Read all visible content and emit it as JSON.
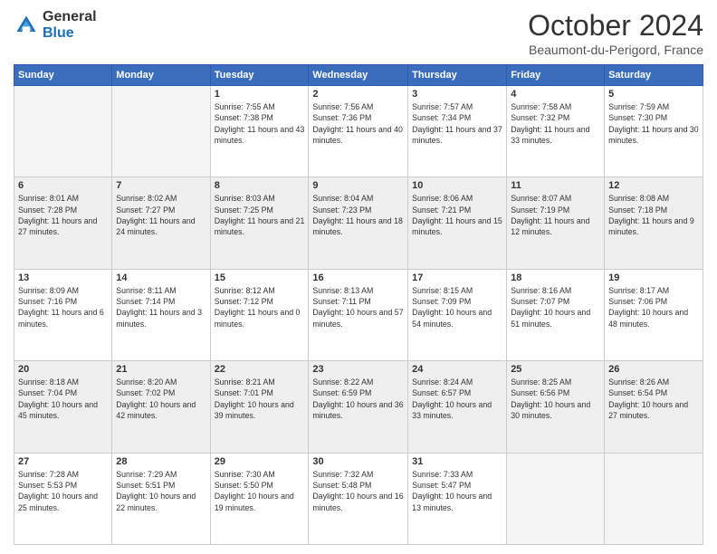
{
  "header": {
    "logo_general": "General",
    "logo_blue": "Blue",
    "month": "October 2024",
    "location": "Beaumont-du-Perigord, France"
  },
  "weekdays": [
    "Sunday",
    "Monday",
    "Tuesday",
    "Wednesday",
    "Thursday",
    "Friday",
    "Saturday"
  ],
  "weeks": [
    [
      {
        "day": "",
        "sunrise": "",
        "sunset": "",
        "daylight": ""
      },
      {
        "day": "",
        "sunrise": "",
        "sunset": "",
        "daylight": ""
      },
      {
        "day": "1",
        "sunrise": "Sunrise: 7:55 AM",
        "sunset": "Sunset: 7:38 PM",
        "daylight": "Daylight: 11 hours and 43 minutes."
      },
      {
        "day": "2",
        "sunrise": "Sunrise: 7:56 AM",
        "sunset": "Sunset: 7:36 PM",
        "daylight": "Daylight: 11 hours and 40 minutes."
      },
      {
        "day": "3",
        "sunrise": "Sunrise: 7:57 AM",
        "sunset": "Sunset: 7:34 PM",
        "daylight": "Daylight: 11 hours and 37 minutes."
      },
      {
        "day": "4",
        "sunrise": "Sunrise: 7:58 AM",
        "sunset": "Sunset: 7:32 PM",
        "daylight": "Daylight: 11 hours and 33 minutes."
      },
      {
        "day": "5",
        "sunrise": "Sunrise: 7:59 AM",
        "sunset": "Sunset: 7:30 PM",
        "daylight": "Daylight: 11 hours and 30 minutes."
      }
    ],
    [
      {
        "day": "6",
        "sunrise": "Sunrise: 8:01 AM",
        "sunset": "Sunset: 7:28 PM",
        "daylight": "Daylight: 11 hours and 27 minutes."
      },
      {
        "day": "7",
        "sunrise": "Sunrise: 8:02 AM",
        "sunset": "Sunset: 7:27 PM",
        "daylight": "Daylight: 11 hours and 24 minutes."
      },
      {
        "day": "8",
        "sunrise": "Sunrise: 8:03 AM",
        "sunset": "Sunset: 7:25 PM",
        "daylight": "Daylight: 11 hours and 21 minutes."
      },
      {
        "day": "9",
        "sunrise": "Sunrise: 8:04 AM",
        "sunset": "Sunset: 7:23 PM",
        "daylight": "Daylight: 11 hours and 18 minutes."
      },
      {
        "day": "10",
        "sunrise": "Sunrise: 8:06 AM",
        "sunset": "Sunset: 7:21 PM",
        "daylight": "Daylight: 11 hours and 15 minutes."
      },
      {
        "day": "11",
        "sunrise": "Sunrise: 8:07 AM",
        "sunset": "Sunset: 7:19 PM",
        "daylight": "Daylight: 11 hours and 12 minutes."
      },
      {
        "day": "12",
        "sunrise": "Sunrise: 8:08 AM",
        "sunset": "Sunset: 7:18 PM",
        "daylight": "Daylight: 11 hours and 9 minutes."
      }
    ],
    [
      {
        "day": "13",
        "sunrise": "Sunrise: 8:09 AM",
        "sunset": "Sunset: 7:16 PM",
        "daylight": "Daylight: 11 hours and 6 minutes."
      },
      {
        "day": "14",
        "sunrise": "Sunrise: 8:11 AM",
        "sunset": "Sunset: 7:14 PM",
        "daylight": "Daylight: 11 hours and 3 minutes."
      },
      {
        "day": "15",
        "sunrise": "Sunrise: 8:12 AM",
        "sunset": "Sunset: 7:12 PM",
        "daylight": "Daylight: 11 hours and 0 minutes."
      },
      {
        "day": "16",
        "sunrise": "Sunrise: 8:13 AM",
        "sunset": "Sunset: 7:11 PM",
        "daylight": "Daylight: 10 hours and 57 minutes."
      },
      {
        "day": "17",
        "sunrise": "Sunrise: 8:15 AM",
        "sunset": "Sunset: 7:09 PM",
        "daylight": "Daylight: 10 hours and 54 minutes."
      },
      {
        "day": "18",
        "sunrise": "Sunrise: 8:16 AM",
        "sunset": "Sunset: 7:07 PM",
        "daylight": "Daylight: 10 hours and 51 minutes."
      },
      {
        "day": "19",
        "sunrise": "Sunrise: 8:17 AM",
        "sunset": "Sunset: 7:06 PM",
        "daylight": "Daylight: 10 hours and 48 minutes."
      }
    ],
    [
      {
        "day": "20",
        "sunrise": "Sunrise: 8:18 AM",
        "sunset": "Sunset: 7:04 PM",
        "daylight": "Daylight: 10 hours and 45 minutes."
      },
      {
        "day": "21",
        "sunrise": "Sunrise: 8:20 AM",
        "sunset": "Sunset: 7:02 PM",
        "daylight": "Daylight: 10 hours and 42 minutes."
      },
      {
        "day": "22",
        "sunrise": "Sunrise: 8:21 AM",
        "sunset": "Sunset: 7:01 PM",
        "daylight": "Daylight: 10 hours and 39 minutes."
      },
      {
        "day": "23",
        "sunrise": "Sunrise: 8:22 AM",
        "sunset": "Sunset: 6:59 PM",
        "daylight": "Daylight: 10 hours and 36 minutes."
      },
      {
        "day": "24",
        "sunrise": "Sunrise: 8:24 AM",
        "sunset": "Sunset: 6:57 PM",
        "daylight": "Daylight: 10 hours and 33 minutes."
      },
      {
        "day": "25",
        "sunrise": "Sunrise: 8:25 AM",
        "sunset": "Sunset: 6:56 PM",
        "daylight": "Daylight: 10 hours and 30 minutes."
      },
      {
        "day": "26",
        "sunrise": "Sunrise: 8:26 AM",
        "sunset": "Sunset: 6:54 PM",
        "daylight": "Daylight: 10 hours and 27 minutes."
      }
    ],
    [
      {
        "day": "27",
        "sunrise": "Sunrise: 7:28 AM",
        "sunset": "Sunset: 5:53 PM",
        "daylight": "Daylight: 10 hours and 25 minutes."
      },
      {
        "day": "28",
        "sunrise": "Sunrise: 7:29 AM",
        "sunset": "Sunset: 5:51 PM",
        "daylight": "Daylight: 10 hours and 22 minutes."
      },
      {
        "day": "29",
        "sunrise": "Sunrise: 7:30 AM",
        "sunset": "Sunset: 5:50 PM",
        "daylight": "Daylight: 10 hours and 19 minutes."
      },
      {
        "day": "30",
        "sunrise": "Sunrise: 7:32 AM",
        "sunset": "Sunset: 5:48 PM",
        "daylight": "Daylight: 10 hours and 16 minutes."
      },
      {
        "day": "31",
        "sunrise": "Sunrise: 7:33 AM",
        "sunset": "Sunset: 5:47 PM",
        "daylight": "Daylight: 10 hours and 13 minutes."
      },
      {
        "day": "",
        "sunrise": "",
        "sunset": "",
        "daylight": ""
      },
      {
        "day": "",
        "sunrise": "",
        "sunset": "",
        "daylight": ""
      }
    ]
  ]
}
